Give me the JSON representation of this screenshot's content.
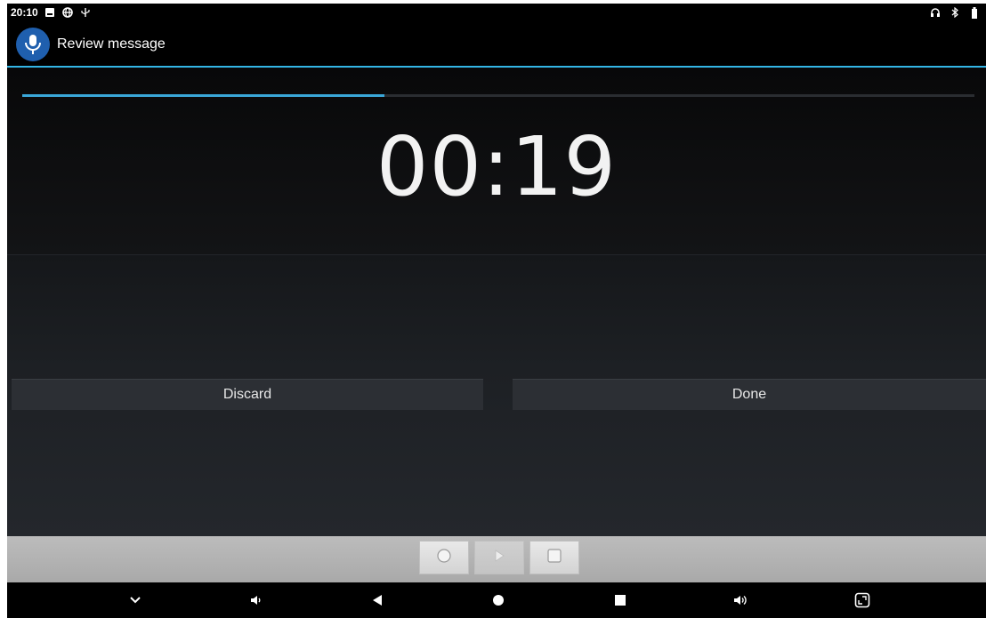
{
  "status_bar": {
    "time": "20:10",
    "left_icons": [
      "notification-icon",
      "vpn-globe-icon",
      "usb-icon"
    ],
    "right_icons": [
      "headset-icon",
      "bluetooth-icon",
      "battery-icon"
    ]
  },
  "action_bar": {
    "title": "Review message",
    "app_icon": "microphone-icon"
  },
  "recording": {
    "elapsed": "00:19",
    "progress_fraction": 0.38
  },
  "buttons": {
    "discard_label": "Discard",
    "done_label": "Done"
  },
  "media_controls": [
    {
      "name": "record",
      "icon": "record-circle-icon",
      "enabled": true
    },
    {
      "name": "play",
      "icon": "play-icon",
      "enabled": false
    },
    {
      "name": "stop",
      "icon": "stop-square-icon",
      "enabled": true
    }
  ],
  "nav_bar": [
    "hide-keyboard-chevron-icon",
    "volume-down-icon",
    "back-icon",
    "home-icon",
    "recents-icon",
    "volume-up-icon",
    "screenshot-icon"
  ],
  "colors": {
    "accent": "#33b5e5",
    "progress": "#3aa7d8",
    "app_icon_bg": "#1f5fae"
  }
}
